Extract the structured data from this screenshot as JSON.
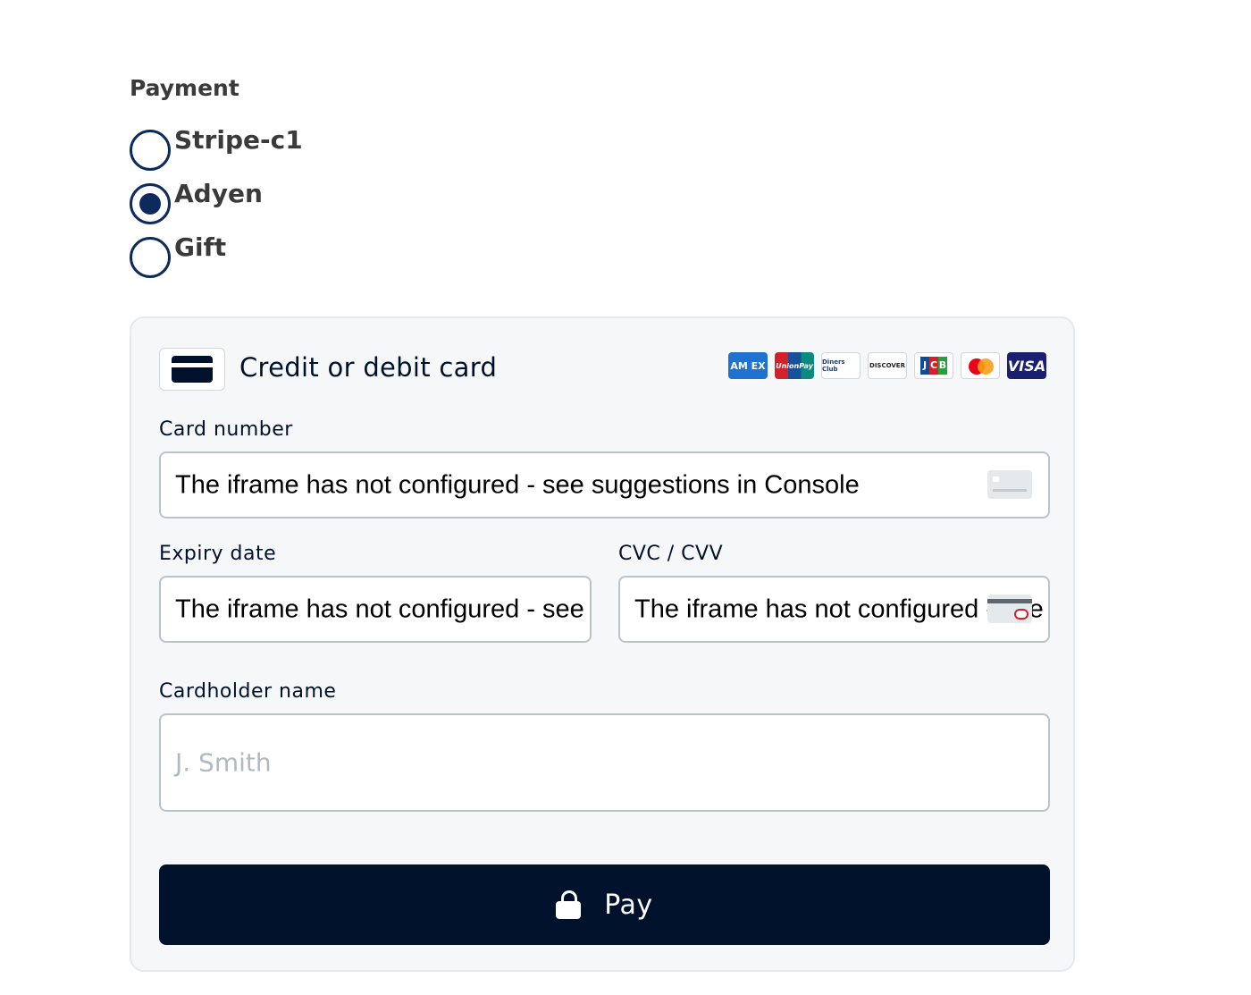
{
  "payment": {
    "title": "Payment",
    "options": [
      {
        "label": "Stripe-c1",
        "selected": false
      },
      {
        "label": "Adyen",
        "selected": true
      },
      {
        "label": "Gift",
        "selected": false
      }
    ]
  },
  "card_form": {
    "title": "Credit or debit card",
    "brands": {
      "amex": "AM EX",
      "unionpay": "UnionPay",
      "diners": "Diners Club",
      "discover": "DISCOVER",
      "jcb": [
        "J",
        "C",
        "B"
      ],
      "visa": "VISA"
    },
    "card_number": {
      "label": "Card number",
      "value": "The iframe has not configured - see suggestions in Console"
    },
    "expiry": {
      "label": "Expiry date",
      "value": "The iframe has not configured - see suggestions in Console"
    },
    "cvc": {
      "label": "CVC / CVV",
      "value": "The iframe has not configured - see suggestions in Console"
    },
    "holder": {
      "label": "Cardholder name",
      "placeholder": "J. Smith"
    },
    "pay_button": "Pay"
  },
  "colors": {
    "primary": "#00112c",
    "radio": "#0c2a5c",
    "panel_bg": "#f6f7f9",
    "input_border": "#b9c4c9"
  },
  "icons": [
    "credit-card-icon",
    "card-number-icon",
    "cvc-icon",
    "lock-icon"
  ]
}
